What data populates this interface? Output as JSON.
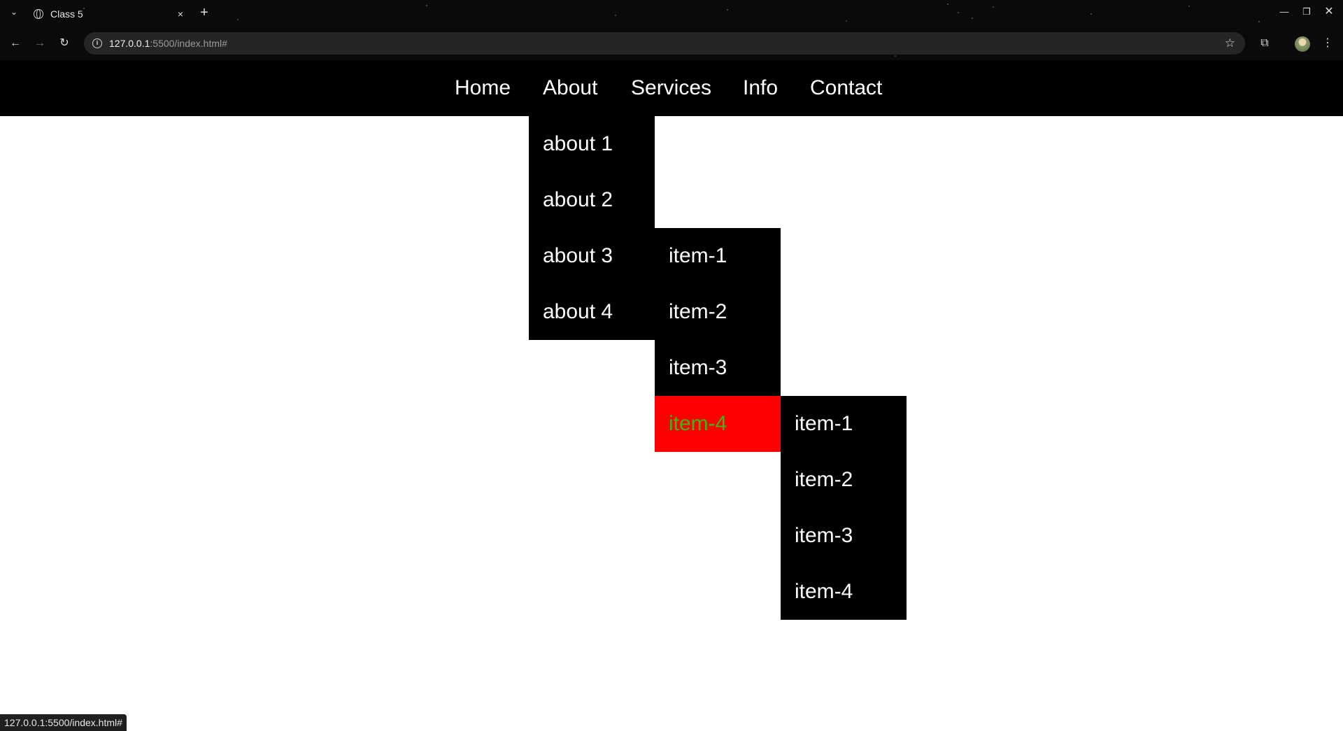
{
  "browser": {
    "tab_title": "Class 5",
    "tab_close": "×",
    "new_tab": "+",
    "url_host": "127.0.0.1",
    "url_rest": ":5500/index.html#",
    "status_url": "127.0.0.1:5500/index.html#",
    "icons": [
      "tab-list-icon",
      "globe-icon",
      "close-icon",
      "plus-icon",
      "minimize-icon",
      "restore-icon",
      "back-icon",
      "forward-icon",
      "reload-icon",
      "info-icon",
      "star-icon",
      "extensions-icon",
      "menu-icon"
    ]
  },
  "nav": {
    "items": [
      "Home",
      "About",
      "Services",
      "Info",
      "Contact"
    ]
  },
  "about_menu": {
    "items": [
      "about 1",
      "about 2",
      "about 3",
      "about 4"
    ]
  },
  "about3_submenu": {
    "items": [
      "item-1",
      "item-2",
      "item-3",
      "item-4"
    ],
    "active": "item-4"
  },
  "item4_submenu": {
    "items": [
      "item-1",
      "item-2",
      "item-3",
      "item-4"
    ]
  },
  "colors": {
    "navbar_bg": "#000000",
    "menu_bg": "#000000",
    "menu_text": "#ffffff",
    "hover_bg": "#ff0000",
    "hover_text": "#33bb11"
  }
}
